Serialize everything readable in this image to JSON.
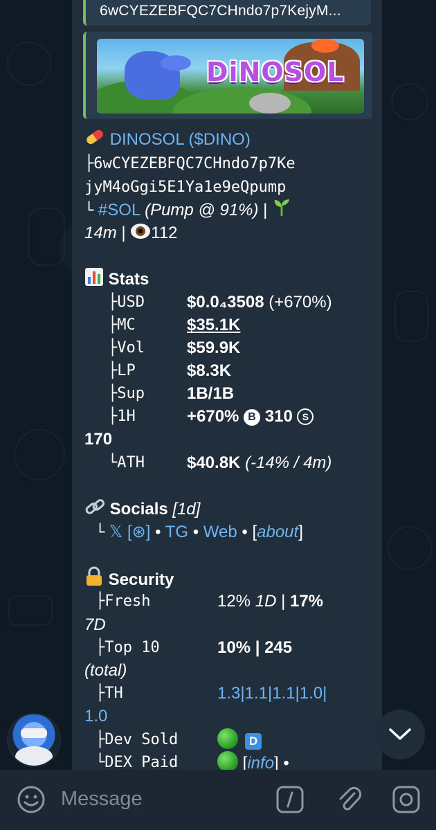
{
  "reply": {
    "text": "6wCYEZEBFQC7CHndo7p7KejyM..."
  },
  "banner": {
    "logo_text": "DiNOSOL"
  },
  "token": {
    "pill_icon": "pill-emoji",
    "name": "DINOSOL",
    "ticker": "($DINO)",
    "address_line1": "├6wCYEZEBFQC7CHndo7p7Ke",
    "address_line2": "jyM4oGgi5E1Ya1e9eQpump",
    "chain_prefix": "└",
    "chain": "#SOL",
    "platform": "(Pump @ 91%)",
    "sep": "|",
    "age": "14m",
    "views_sep": "|",
    "views": "112"
  },
  "stats": {
    "title": "Stats",
    "rows": [
      {
        "key": "├USD",
        "value": "$0.0₄3508",
        "extra": "(+670%)"
      },
      {
        "key": "├MC",
        "value": "$35.1K"
      },
      {
        "key": "├Vol",
        "value": "$59.9K"
      },
      {
        "key": "├LP",
        "value": "$8.3K"
      },
      {
        "key": "├Sup",
        "value": "1B/1B"
      },
      {
        "key": "├1H",
        "value": "+670%",
        "buys": "310",
        "sells_wrap": "170"
      },
      {
        "key": "└ATH",
        "value": "$40.8K",
        "extra": "(-14% / 4m)"
      }
    ],
    "buy_letter": "B",
    "sell_letter": "S"
  },
  "socials": {
    "title": "Socials",
    "age": "[1d]",
    "prefix": "└",
    "x": "𝕏",
    "x_extra": "[⊛]",
    "dot1": "•",
    "tg": "TG",
    "dot2": "•",
    "web": "Web",
    "dot3": "•",
    "about": "about"
  },
  "security": {
    "title": "Security",
    "fresh_key": "├Fresh",
    "fresh_val1": "12%",
    "fresh_1d": "1D",
    "fresh_sep": "|",
    "fresh_val2": "17%",
    "fresh_7d": "7D",
    "top10_key": "├Top 10",
    "top10_val": "10% | 245",
    "top10_total": "(total)",
    "th_key": "├TH",
    "th_val": "1.3|1.1|1.1|1.0|",
    "th_wrap": "1.0",
    "devsold_key": "├Dev Sold",
    "devsold_badge": "D",
    "dexpaid_key": "└DEX Paid",
    "dexpaid_info": "info",
    "dexpaid_tail": "•"
  },
  "composer": {
    "placeholder": "Message"
  },
  "colors": {
    "link": "#6fb4f0",
    "bubble": "#212f3d",
    "accent_green": "#67c25a"
  }
}
